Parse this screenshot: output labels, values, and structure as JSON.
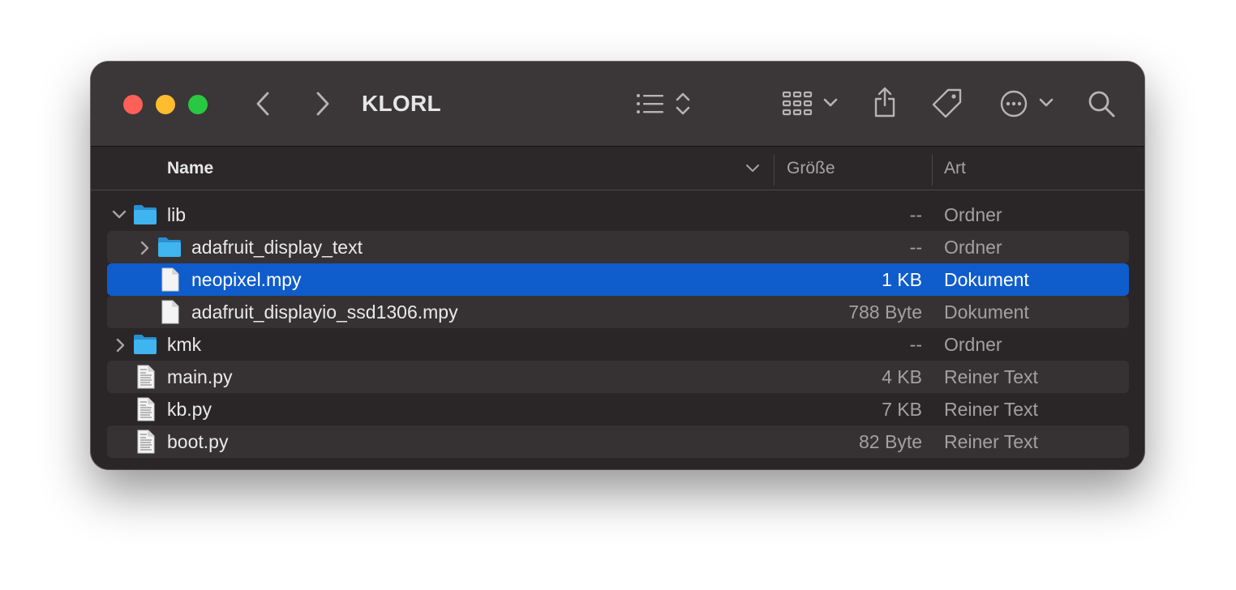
{
  "window": {
    "title": "KLORL"
  },
  "toolbar": {
    "icons": [
      "back-icon",
      "forward-icon",
      "list-view-icon",
      "sort-icon",
      "group-icon",
      "chevron-down-icon",
      "share-icon",
      "tag-icon",
      "more-icon",
      "search-icon"
    ]
  },
  "columns": {
    "name": "Name",
    "size": "Größe",
    "kind": "Art"
  },
  "colors": {
    "selection": "#0f5ccc",
    "folder": "#3fb4ef"
  },
  "rows": [
    {
      "name": "lib",
      "size": "--",
      "kind": "Ordner",
      "icon": "folder-icon",
      "expanded": true,
      "level": 0
    },
    {
      "name": "adafruit_display_text",
      "size": "--",
      "kind": "Ordner",
      "icon": "folder-icon",
      "expanded": false,
      "level": 1
    },
    {
      "name": "neopixel.mpy",
      "size": "1 KB",
      "kind": "Dokument",
      "icon": "document-icon",
      "selected": true,
      "level": 1
    },
    {
      "name": "adafruit_displayio_ssd1306.mpy",
      "size": "788 Byte",
      "kind": "Dokument",
      "icon": "document-icon",
      "level": 1
    },
    {
      "name": "kmk",
      "size": "--",
      "kind": "Ordner",
      "icon": "folder-icon",
      "expanded": false,
      "level": 0
    },
    {
      "name": "main.py",
      "size": "4 KB",
      "kind": "Reiner Text",
      "icon": "text-file-icon",
      "level": 0
    },
    {
      "name": "kb.py",
      "size": "7 KB",
      "kind": "Reiner Text",
      "icon": "text-file-icon",
      "level": 0
    },
    {
      "name": "boot.py",
      "size": "82 Byte",
      "kind": "Reiner Text",
      "icon": "text-file-icon",
      "level": 0
    }
  ]
}
